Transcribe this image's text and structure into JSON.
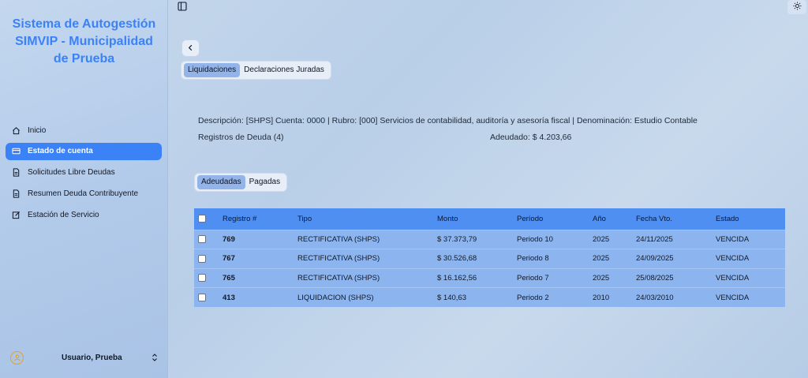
{
  "sidebar": {
    "app_title": "Sistema de Autogestión SIMVIP - Municipalidad de Prueba",
    "items": [
      {
        "label": "Inicio",
        "icon": "home-icon"
      },
      {
        "label": "Estado de cuenta",
        "icon": "credit-card-icon",
        "active": true
      },
      {
        "label": "Solicitudes Libre Deudas",
        "icon": "document-icon"
      },
      {
        "label": "Resumen Deuda Contribuyente",
        "icon": "document-icon"
      },
      {
        "label": "Estación de Servicio",
        "icon": "edit-icon"
      }
    ],
    "user": {
      "name": "Usuario, Prueba",
      "icon": "user-circle-icon"
    }
  },
  "main": {
    "tabs": [
      {
        "label": "Liquidaciones",
        "active": true
      },
      {
        "label": "Declaraciones Juradas",
        "active": false
      }
    ],
    "description": "Descripción: [SHPS] Cuenta: 0000 | Rubro: [000] Servicios de contabilidad, auditoría y asesoría fiscal | Denominación: Estudio Contable",
    "registros": "Registros de Deuda (4)",
    "adeudado": "Adeudado: $ 4.203,66",
    "subtabs": [
      {
        "label": "Adeudadas",
        "active": true
      },
      {
        "label": "Pagadas",
        "active": false
      }
    ],
    "table": {
      "columns": [
        "Registro #",
        "Tipo",
        "Monto",
        "Período",
        "Año",
        "Fecha Vto.",
        "Estado"
      ],
      "rows": [
        {
          "registro": "769",
          "tipo": "RECTIFICATIVA (SHPS)",
          "monto": "$ 37.373,79",
          "periodo": "Periodo 10",
          "anio": "2025",
          "fecha": "24/11/2025",
          "estado": "VENCIDA"
        },
        {
          "registro": "767",
          "tipo": "RECTIFICATIVA (SHPS)",
          "monto": "$ 30.526,68",
          "periodo": "Periodo 8",
          "anio": "2025",
          "fecha": "24/09/2025",
          "estado": "VENCIDA"
        },
        {
          "registro": "765",
          "tipo": "RECTIFICATIVA (SHPS)",
          "monto": "$ 16.162,56",
          "periodo": "Periodo 7",
          "anio": "2025",
          "fecha": "25/08/2025",
          "estado": "VENCIDA"
        },
        {
          "registro": "413",
          "tipo": "LIQUIDACION (SHPS)",
          "monto": "$ 140,63",
          "periodo": "Periodo 2",
          "anio": "2010",
          "fecha": "24/03/2010",
          "estado": "VENCIDA"
        }
      ]
    }
  },
  "colors": {
    "accent": "#3b82f6",
    "header": "#4f8ff2",
    "row": "#8cb5f0"
  }
}
